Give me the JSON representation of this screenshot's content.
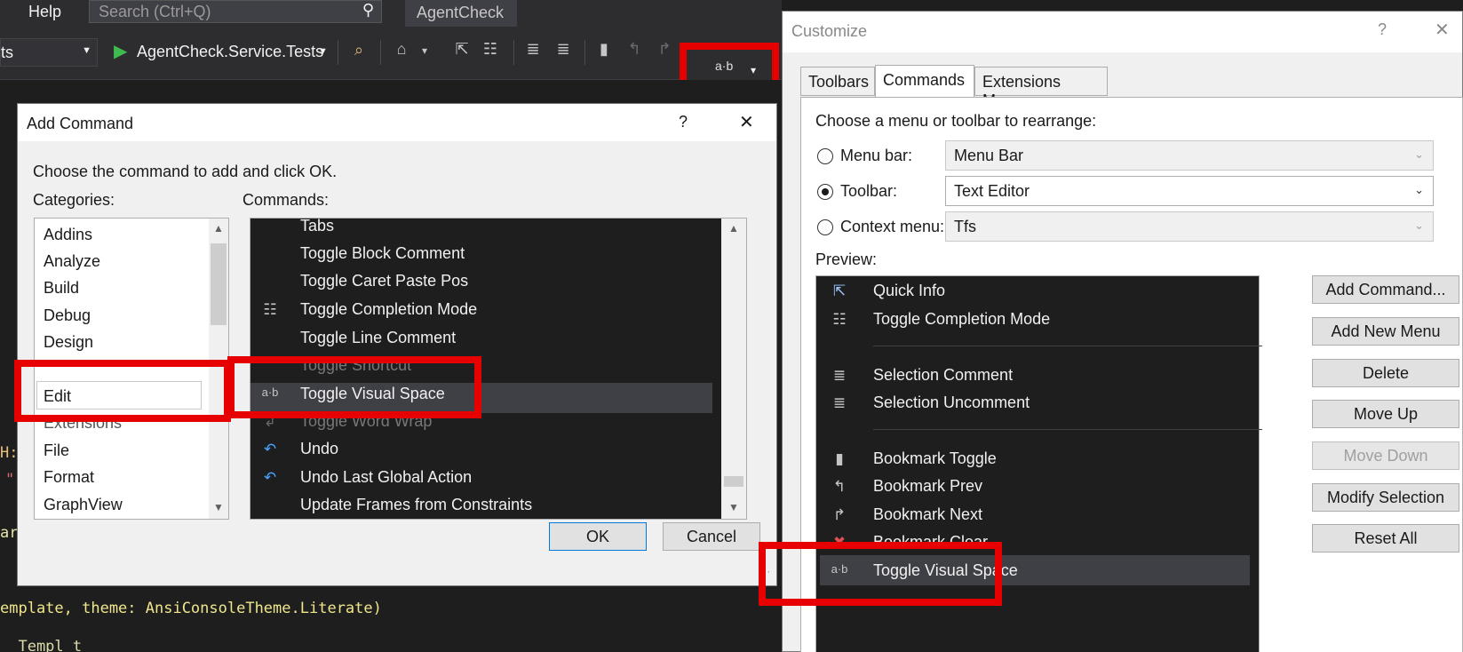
{
  "ide": {
    "menu_help": "Help",
    "search_placeholder": "Search (Ctrl+Q)",
    "solution_name": "AgentCheck",
    "config_dropdown": "ts",
    "startup_project": "AgentCheck.Service.Tests",
    "code_line1": "H:m",
    "code_line2": "\"",
    "code_line3": "arn",
    "code_line4": "emplate, theme: AnsiConsoleTheme.Literate)",
    "code_line5": "  Templ t"
  },
  "add_command": {
    "title": "Add Command",
    "help": "?",
    "close": "✕",
    "instruction": "Choose the command to add and click OK.",
    "categories_label": "Categories:",
    "commands_label": "Commands:",
    "categories": [
      "Addins",
      "Analyze",
      "Build",
      "Debug",
      "Design",
      "Edit",
      "Extensions",
      "File",
      "Format",
      "GraphView"
    ],
    "commands": [
      {
        "label": "Tabs",
        "icon": ""
      },
      {
        "label": "Toggle Block Comment",
        "icon": ""
      },
      {
        "label": "Toggle Caret Paste Pos",
        "icon": ""
      },
      {
        "label": "Toggle Completion Mode",
        "icon": "completion-mode-icon"
      },
      {
        "label": "Toggle Line Comment",
        "icon": ""
      },
      {
        "label": "Toggle Shortcut",
        "icon": ""
      },
      {
        "label": "Toggle Visual Space",
        "icon": "visual-space-icon"
      },
      {
        "label": "Toggle Word Wrap",
        "icon": "word-wrap-icon"
      },
      {
        "label": "Undo",
        "icon": "undo-icon"
      },
      {
        "label": "Undo Last Global Action",
        "icon": "undo-icon"
      },
      {
        "label": "Update Frames from Constraints",
        "icon": ""
      }
    ],
    "ok": "OK",
    "cancel": "Cancel"
  },
  "customize": {
    "title": "Customize",
    "help": "?",
    "close": "✕",
    "tabs": [
      "Toolbars",
      "Commands",
      "Extensions Menu"
    ],
    "active_tab": "Commands",
    "choose_label": "Choose a menu or toolbar to rearrange:",
    "menu_bar_label": "Menu bar:",
    "menu_bar_value": "Menu Bar",
    "toolbar_label": "Toolbar:",
    "toolbar_value": "Text Editor",
    "context_menu_label": "Context menu:",
    "context_menu_value": "Tfs",
    "selected_option": "Toolbar",
    "preview_label": "Preview:",
    "preview_items": [
      {
        "label": "Quick Info",
        "icon": "quick-info-icon"
      },
      {
        "label": "Toggle Completion Mode",
        "icon": "completion-mode-icon"
      },
      {
        "label": "Selection Comment",
        "icon": "comment-icon"
      },
      {
        "label": "Selection Uncomment",
        "icon": "uncomment-icon"
      },
      {
        "label": "Bookmark Toggle",
        "icon": "bookmark-icon"
      },
      {
        "label": "Bookmark Prev",
        "icon": "bookmark-prev-icon"
      },
      {
        "label": "Bookmark Next",
        "icon": "bookmark-next-icon"
      },
      {
        "label": "Bookmark Clear",
        "icon": "bookmark-clear-icon"
      },
      {
        "label": "Toggle Visual Space",
        "icon": "visual-space-icon"
      }
    ],
    "buttons": {
      "add_command": "Add Command...",
      "add_new_menu": "Add New Menu",
      "delete": "Delete",
      "move_up": "Move Up",
      "move_down": "Move Down",
      "modify_selection": "Modify Selection",
      "reset_all": "Reset All"
    }
  },
  "colors": {
    "highlight_red": "#e60000",
    "ide_bg": "#1e1e1e",
    "dialog_bg": "#f0f0f0",
    "selection_dark": "#3f3f46"
  }
}
